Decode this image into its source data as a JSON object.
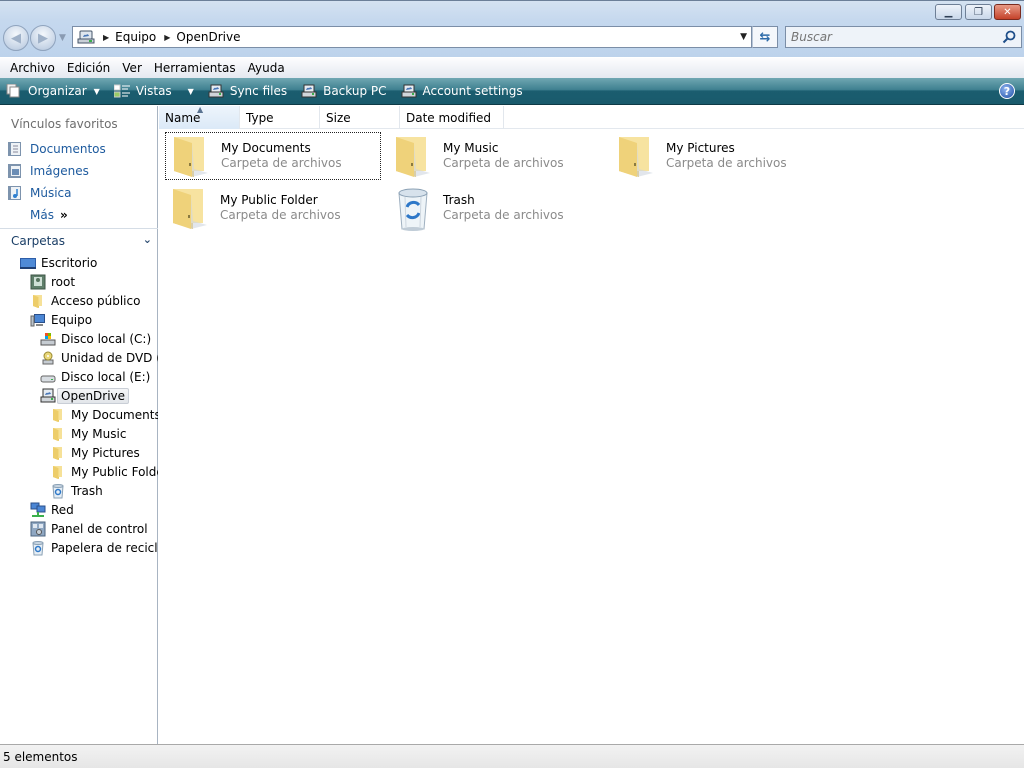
{
  "window": {
    "controls": {
      "minimize": "minimize",
      "maximize": "restore",
      "close": "close"
    }
  },
  "navigation": {
    "breadcrumb": [
      "Equipo",
      "OpenDrive"
    ],
    "search_placeholder": "Buscar"
  },
  "menubar": {
    "items": [
      "Archivo",
      "Edición",
      "Ver",
      "Herramientas",
      "Ayuda"
    ]
  },
  "toolbar": {
    "items": [
      {
        "label": "Organizar",
        "icon": "organize-icon",
        "has_dropdown": true
      },
      {
        "label": "Vistas",
        "icon": "views-icon",
        "has_dropdown": true
      },
      {
        "label": "Sync files",
        "icon": "opendrive-icon",
        "has_dropdown": false
      },
      {
        "label": "Backup PC",
        "icon": "opendrive-icon",
        "has_dropdown": false
      },
      {
        "label": "Account settings",
        "icon": "opendrive-icon",
        "has_dropdown": false
      }
    ],
    "help_icon": "help-icon"
  },
  "sidebar": {
    "favorites_title": "Vínculos favoritos",
    "favorites": [
      {
        "label": "Documentos",
        "icon": "documents-icon"
      },
      {
        "label": "Imágenes",
        "icon": "pictures-icon"
      },
      {
        "label": "Música",
        "icon": "music-icon"
      }
    ],
    "more_label": "Más",
    "more_glyph": "»",
    "folders_title": "Carpetas",
    "tree": [
      {
        "label": "Escritorio",
        "icon": "desktop-icon",
        "level": 0
      },
      {
        "label": "root",
        "icon": "user-icon",
        "level": 1
      },
      {
        "label": "Acceso público",
        "icon": "folder-icon",
        "level": 1
      },
      {
        "label": "Equipo",
        "icon": "computer-icon",
        "level": 1
      },
      {
        "label": "Disco local (C:)",
        "icon": "system-drive-icon",
        "level": 2
      },
      {
        "label": "Unidad de DVD (D",
        "icon": "dvd-drive-icon",
        "level": 2
      },
      {
        "label": "Disco local (E:)",
        "icon": "drive-icon",
        "level": 2
      },
      {
        "label": "OpenDrive",
        "icon": "opendrive-icon",
        "level": 2,
        "selected": true
      },
      {
        "label": "My Documents",
        "icon": "folder-icon",
        "level": 3
      },
      {
        "label": "My Music",
        "icon": "folder-icon",
        "level": 3
      },
      {
        "label": "My Pictures",
        "icon": "folder-icon",
        "level": 3
      },
      {
        "label": "My Public Folde",
        "icon": "folder-icon",
        "level": 3
      },
      {
        "label": "Trash",
        "icon": "recycle-bin-icon",
        "level": 3
      },
      {
        "label": "Red",
        "icon": "network-icon",
        "level": 1
      },
      {
        "label": "Panel de control",
        "icon": "control-panel-icon",
        "level": 1
      },
      {
        "label": "Papelera de reciclaje",
        "icon": "recycle-bin-icon",
        "level": 1
      }
    ]
  },
  "content": {
    "columns": [
      "Name",
      "Type",
      "Size",
      "Date modified"
    ],
    "sorted_column": "Name",
    "items": [
      {
        "name": "My Documents",
        "type": "Carpeta de archivos",
        "icon": "folder-icon",
        "focused": true
      },
      {
        "name": "My Music",
        "type": "Carpeta de archivos",
        "icon": "folder-icon"
      },
      {
        "name": "My Pictures",
        "type": "Carpeta de archivos",
        "icon": "folder-icon"
      },
      {
        "name": "My Public Folder",
        "type": "Carpeta de archivos",
        "icon": "folder-icon"
      },
      {
        "name": "Trash",
        "type": "Carpeta de archivos",
        "icon": "recycle-bin-icon"
      }
    ]
  },
  "statusbar": {
    "text": "5 elementos"
  }
}
